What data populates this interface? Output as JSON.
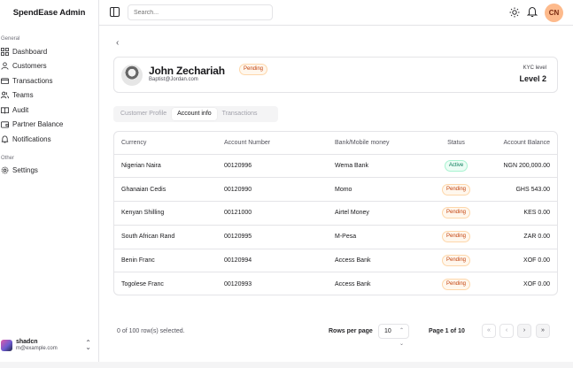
{
  "sidebar": {
    "brand": "SpendEase Admin",
    "general_label": "General",
    "items": [
      {
        "label": "Dashboard",
        "icon": "dashboard-icon"
      },
      {
        "label": "Customers",
        "icon": "user-icon"
      },
      {
        "label": "Transactions",
        "icon": "card-icon"
      },
      {
        "label": "Teams",
        "icon": "users-icon"
      },
      {
        "label": "Audit",
        "icon": "book-icon"
      },
      {
        "label": "Partner Balance",
        "icon": "wallet-icon"
      },
      {
        "label": "Notifications",
        "icon": "bell-icon"
      }
    ],
    "other_label": "Other",
    "other_items": [
      {
        "label": "Settings",
        "icon": "settings-icon"
      }
    ],
    "user": {
      "name": "shadcn",
      "email": "m@example.com"
    }
  },
  "topbar": {
    "search_placeholder": "Search...",
    "avatar_initials": "CN"
  },
  "profile": {
    "name": "John Zechariah",
    "email": "Baptist@Jordan.com",
    "status": "Pending",
    "kyc_label": "KYC level",
    "kyc_level": "Level 2"
  },
  "tabs": [
    "Customer Profile",
    "Account info",
    "Transactions"
  ],
  "active_tab": "Account info",
  "table": {
    "headers": [
      "Currency",
      "Account Number",
      "Bank/Mobile money",
      "Status",
      "Account Balance"
    ],
    "rows": [
      {
        "currency": "Nigerian Naira",
        "account": "00120996",
        "bank": "Wema Bank",
        "status": "Active",
        "balance": "NGN 200,000.00"
      },
      {
        "currency": "Ghanaian Cedis",
        "account": "00120990",
        "bank": "Momo",
        "status": "Pending",
        "balance": "GHS 543.00"
      },
      {
        "currency": "Kenyan Shilling",
        "account": "00121000",
        "bank": "Airtel Money",
        "status": "Pending",
        "balance": "KES 0.00"
      },
      {
        "currency": "South African Rand",
        "account": "00120995",
        "bank": "M-Pesa",
        "status": "Pending",
        "balance": "ZAR 0.00"
      },
      {
        "currency": "Benin Franc",
        "account": "00120994",
        "bank": "Access Bank",
        "status": "Pending",
        "balance": "XOF 0.00"
      },
      {
        "currency": "Togolese Franc",
        "account": "00120993",
        "bank": "Access Bank",
        "status": "Pending",
        "balance": "XOF 0.00"
      }
    ]
  },
  "footer": {
    "selected": "0 of 100 row(s) selected.",
    "rows_per_page_label": "Rows per page",
    "rows_per_page": "10",
    "page_info": "Page 1 of 10"
  },
  "colors": {
    "accent": "#fdba8c",
    "active_status": "#047857",
    "pending_status": "#c2410c"
  }
}
